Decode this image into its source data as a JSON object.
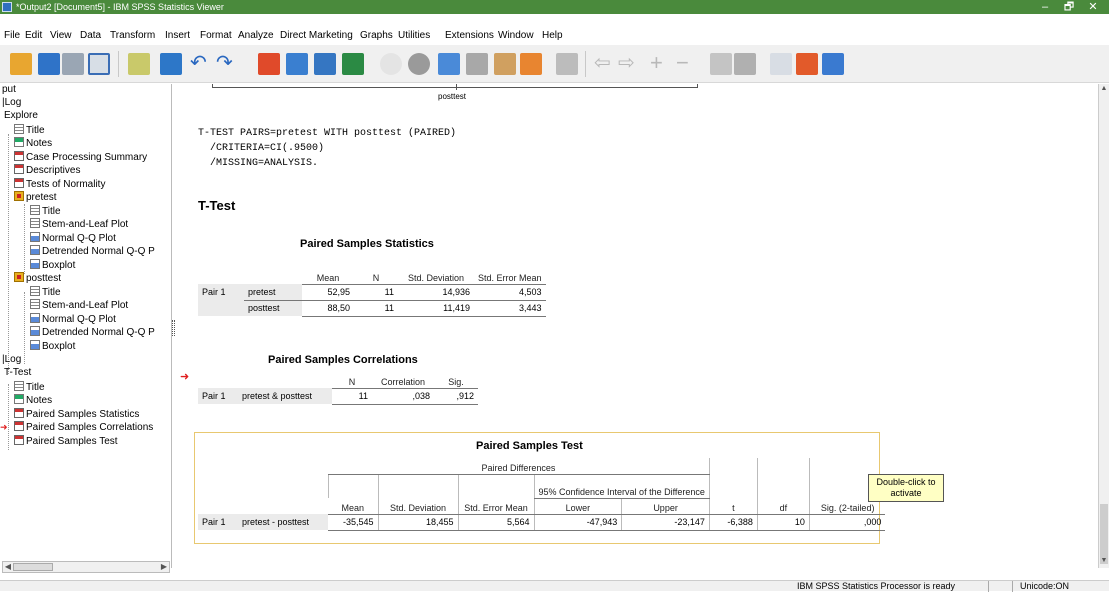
{
  "window": {
    "title": "*Output2 [Document5] - IBM SPSS Statistics Viewer",
    "minimize": "–",
    "maximize": "🗗",
    "close": "✕"
  },
  "menu": [
    "File",
    "Edit",
    "View",
    "Data",
    "Transform",
    "Insert",
    "Format",
    "Analyze",
    "Direct Marketing",
    "Graphs",
    "Utilities",
    "Extensions",
    "Window",
    "Help"
  ],
  "nav": {
    "items": [
      "put",
      "Log",
      "Explore",
      "Title",
      "Notes",
      "Case Processing Summary",
      "Descriptives",
      "Tests of Normality",
      "pretest",
      "Title",
      "Stem-and-Leaf Plot",
      "Normal Q-Q Plot",
      "Detrended Normal Q-Q P",
      "Boxplot",
      "posttest",
      "Title",
      "Stem-and-Leaf Plot",
      "Normal Q-Q Plot",
      "Detrended Normal Q-Q P",
      "Boxplot",
      "Log",
      "T-Test",
      "Title",
      "Notes",
      "Paired Samples Statistics",
      "Paired Samples Correlations",
      "Paired Samples Test"
    ]
  },
  "content": {
    "chart_stub_label": "posttest",
    "syntax": [
      "T-TEST PAIRS=pretest WITH posttest (PAIRED)",
      "  /CRITERIA=CI(.9500)",
      "  /MISSING=ANALYSIS."
    ],
    "heading": "T-Test",
    "stats": {
      "title": "Paired Samples Statistics",
      "headers": [
        "Mean",
        "N",
        "Std. Deviation",
        "Std. Error Mean"
      ],
      "pair": "Pair 1",
      "rows": [
        {
          "var": "pretest",
          "mean": "52,95",
          "n": "11",
          "sd": "14,936",
          "se": "4,503"
        },
        {
          "var": "posttest",
          "mean": "88,50",
          "n": "11",
          "sd": "11,419",
          "se": "3,443"
        }
      ]
    },
    "corr": {
      "title": "Paired Samples Correlations",
      "headers": [
        "N",
        "Correlation",
        "Sig."
      ],
      "pair": "Pair 1",
      "var": "pretest & posttest",
      "n": "11",
      "r": ",038",
      "sig": ",912"
    },
    "test": {
      "title": "Paired Samples Test",
      "group": "Paired Differences",
      "ci_header": "95% Confidence Interval of the Difference",
      "headers": [
        "Mean",
        "Std. Deviation",
        "Std. Error Mean",
        "Lower",
        "Upper",
        "t",
        "df",
        "Sig. (2-tailed)"
      ],
      "pair": "Pair 1",
      "var": "pretest - posttest",
      "mean": "-35,545",
      "sd": "18,455",
      "se": "5,564",
      "lower": "-47,943",
      "upper": "-23,147",
      "t": "-6,388",
      "df": "10",
      "sig": ",000"
    },
    "tooltip": "Double-click to activate"
  },
  "status": {
    "processor": "IBM SPSS Statistics Processor is ready",
    "unicode": "Unicode:ON"
  },
  "colors": {
    "titlebar": "#4a8a3c",
    "selection": "#e8c870",
    "tooltip": "#ffffc4"
  }
}
